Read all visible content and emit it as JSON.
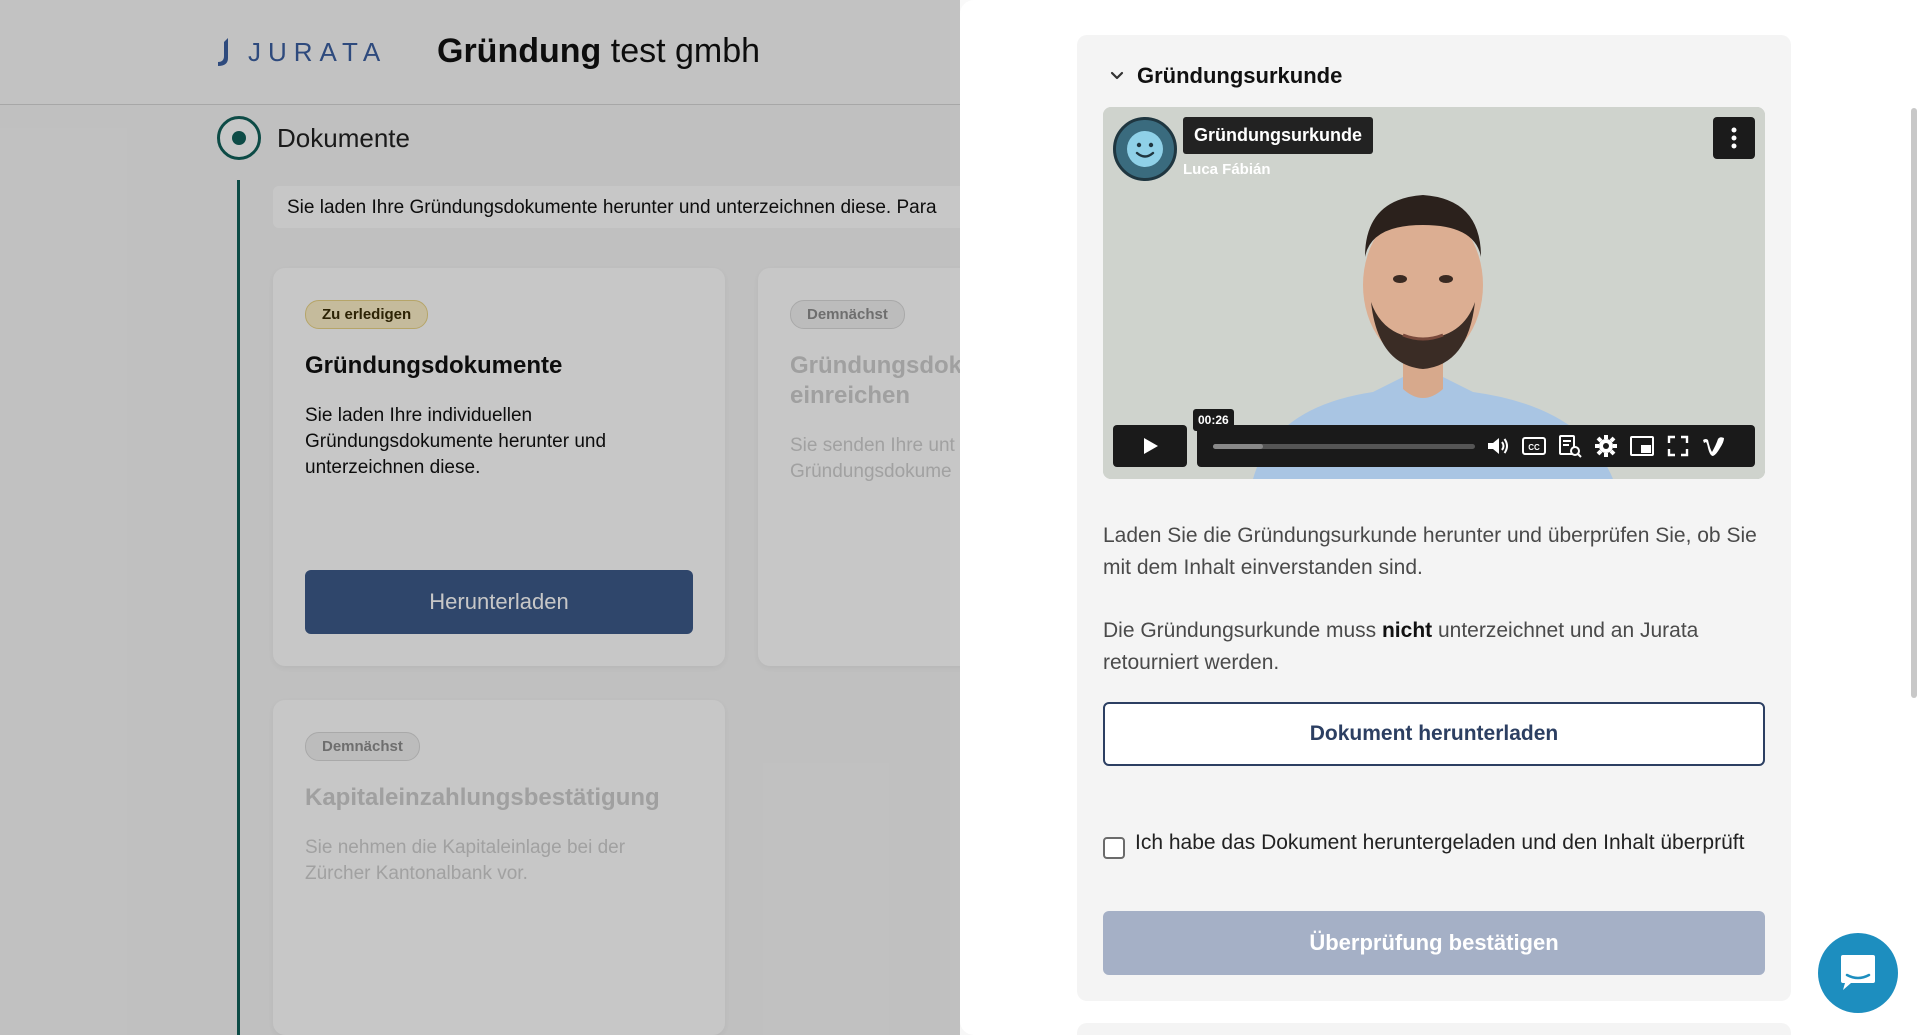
{
  "header": {
    "logo_text": "JURATA",
    "title_bold": "Gründung",
    "title_rest": " test gmbh"
  },
  "step": {
    "label": "Dokumente",
    "info": "Sie laden Ihre Gründungsdokumente herunter und unterzeichnen diese. Para"
  },
  "cards": [
    {
      "badge": "Zu erledigen",
      "title": "Gründungsdokumente",
      "description": "Sie laden Ihre individuellen Gründungsdokumente herunter und unterzeichnen diese.",
      "button": "Herunterladen"
    },
    {
      "badge": "Demnächst",
      "title": "Gründungsdok\neinreichen",
      "description": "Sie senden Ihre unt\nGründungsdokume"
    },
    {
      "badge": "Demnächst",
      "title": "Kapitaleinzahlungsbestätigung",
      "description": "Sie nehmen die Kapitaleinlage bei der Zürcher Kantonalbank vor."
    }
  ],
  "panel": {
    "section_title": "Gründungsurkunde",
    "video": {
      "title": "Gründungsurkunde",
      "author": "Luca Fábián",
      "timestamp": "00:26",
      "progress": 0.19
    },
    "text_1": "Laden Sie die Gründungsurkunde herunter und überprüfen Sie, ob Sie mit dem Inhalt einverstanden sind.",
    "text_2_before": "Die Gründungsurkunde muss ",
    "text_2_bold": "nicht",
    "text_2_after": " unterzeichnet und an Jurata retourniert werden.",
    "download_button": "Dokument herunterladen",
    "checkbox_label": "Ich habe das Dokument heruntergeladen und den Inhalt überprüft",
    "confirm_button": "Überprüfung bestätigen"
  },
  "colors": {
    "accent": "#3d5a8a",
    "timeline": "#11615a",
    "chat": "#1d8ebf",
    "disabled": "#a5b0c6"
  }
}
